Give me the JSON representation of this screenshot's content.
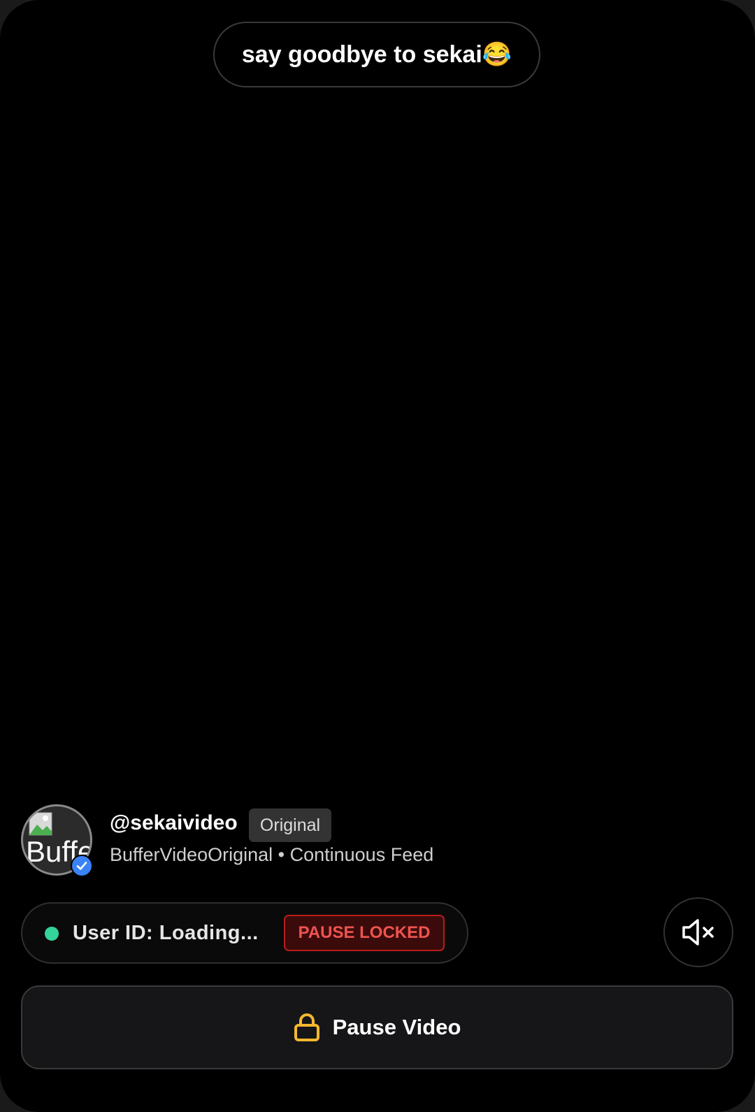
{
  "caption": {
    "text": "say goodbye to sekai😂"
  },
  "author": {
    "avatar_alt": "Buffer",
    "avatar_icon": "broken-image-icon",
    "verified_icon": "verified-check-icon",
    "handle": "@sekaivideo",
    "tag": "Original",
    "subline": "BufferVideoOriginal • Continuous Feed"
  },
  "status": {
    "user_id_text": "User ID: Loading...",
    "indicator_color": "#34d399",
    "badge": "PAUSE LOCKED",
    "badge_color": "#ef5350"
  },
  "controls": {
    "mute_icon": "speaker-muted-icon",
    "pause_icon": "lock-icon",
    "pause_label": "Pause Video",
    "lock_color": "#f5b82e"
  }
}
